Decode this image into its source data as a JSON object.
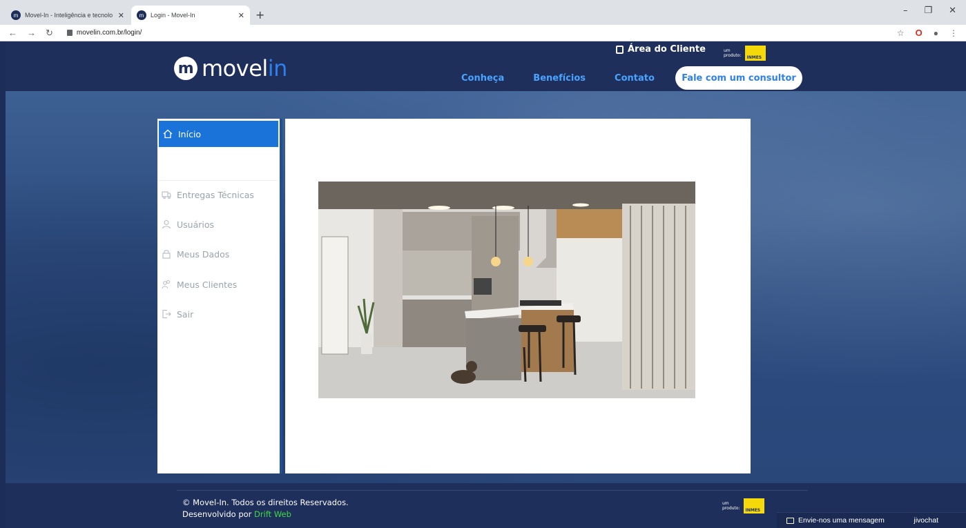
{
  "browser": {
    "tabs": [
      {
        "title": "Movel-In - Inteligência e tecnolo",
        "active": false
      },
      {
        "title": "Login - Movel-In",
        "active": true
      }
    ],
    "url": "movelin.com.br/login/"
  },
  "header": {
    "logo_main": "movel",
    "logo_accent": "in",
    "area_cliente": "Área do Cliente",
    "produto_label_1": "um",
    "produto_label_2": "produto:",
    "inmes": "INMES",
    "menu": [
      "Conheça",
      "Benefícios",
      "Contato"
    ],
    "cta": "Fale com um consultor"
  },
  "sidebar": {
    "items": [
      {
        "label": "Início",
        "icon": "home-icon",
        "active": true
      },
      {
        "label": "Entregas Técnicas",
        "icon": "truck-icon",
        "active": false
      },
      {
        "label": "Usuários",
        "icon": "user-icon",
        "active": false
      },
      {
        "label": "Meus Dados",
        "icon": "lock-icon",
        "active": false
      },
      {
        "label": "Meus Clientes",
        "icon": "users-icon",
        "active": false
      },
      {
        "label": "Sair",
        "icon": "logout-icon",
        "active": false
      }
    ]
  },
  "footer": {
    "copyright": "© Movel-In. Todos os direitos Reservados.",
    "developed_by": "Desenvolvido por",
    "developer": "Drift Web"
  },
  "chat": {
    "message": "Envie-nos uma mensagem",
    "brand": "jivochat"
  },
  "colors": {
    "navy": "#1f2f5b",
    "accent_blue": "#2f80ed",
    "active_item": "#1a73d9",
    "link_blue": "#4aa3ff",
    "drift_green": "#3fdb3f"
  }
}
